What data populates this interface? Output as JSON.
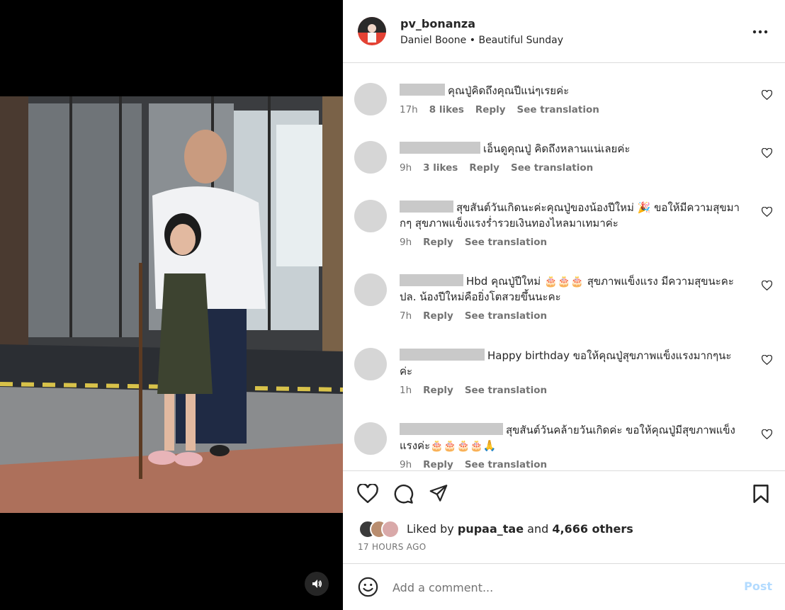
{
  "post": {
    "username": "pv_bonanza",
    "audio_label": "Daniel Boone",
    "separator": "•",
    "track_label": "Beautiful Sunday"
  },
  "comments": [
    {
      "text": "คุณปู่คิดถึงคุณปีแน่ๆเรยค่ะ",
      "time": "17h",
      "likes": "8 likes",
      "reply": "Reply",
      "translate": "See translation"
    },
    {
      "text": "เอ็นดูคุณปู่ คิดถึงหลานแน่เลยค่ะ",
      "time": "9h",
      "likes": "3 likes",
      "reply": "Reply",
      "translate": "See translation"
    },
    {
      "text": "สุขสันต์วันเกิดนะค่ะคุณปู่ของน้องปีใหม่ 🎉 ขอให้มีความสุขมากๆ สุขภาพแข็งแรงร่ำรวยเงินทองไหลมาเทมาค่ะ",
      "time": "9h",
      "likes": "",
      "reply": "Reply",
      "translate": "See translation"
    },
    {
      "text": "Hbd คุณปู่ปีใหม่ 🎂🎂🎂 สุขภาพแข็งแรง มีความสุขนะคะ ปล. น้องปีใหม่คือยิ่งโตสวยขึ้นนะคะ",
      "time": "7h",
      "likes": "",
      "reply": "Reply",
      "translate": "See translation"
    },
    {
      "text": "Happy birthday ขอให้คุณปู่สุขภาพแข็งแรงมากๆนะค่ะ",
      "time": "1h",
      "likes": "",
      "reply": "Reply",
      "translate": "See translation"
    },
    {
      "text": "สุขสันต์วันคล้ายวันเกิดค่ะ ขอให้คุณปู่มีสุขภาพแข็งแรงค่ะ🎂🎂🎂🎂🙏",
      "time": "9h",
      "likes": "",
      "reply": "Reply",
      "translate": "See translation"
    }
  ],
  "likes": {
    "prefix": "Liked by",
    "user": "pupaa_tae",
    "and": "and",
    "others": "4,666 others",
    "time_ago": "17 HOURS AGO"
  },
  "composer": {
    "placeholder": "Add a comment...",
    "post_label": "Post"
  },
  "icons": {
    "more": "more-options-icon",
    "like": "heart-icon",
    "comment": "comment-icon",
    "share": "paper-plane-icon",
    "save": "bookmark-icon",
    "emoji": "emoji-icon",
    "audio": "speaker-icon"
  },
  "colors": {
    "link_disabled": "#b3dbff",
    "muted": "#737373",
    "border": "#dbdbdb"
  }
}
